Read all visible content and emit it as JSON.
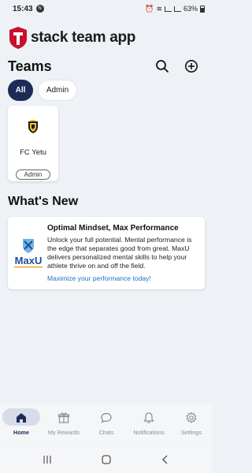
{
  "status_bar": {
    "time": "15:43",
    "notification_badge": "N",
    "battery": "63%"
  },
  "app": {
    "name": "stack team app",
    "brand_color": "#c8102e"
  },
  "teams": {
    "title": "Teams",
    "filters": [
      {
        "label": "All",
        "selected": true
      },
      {
        "label": "Admin",
        "selected": false
      }
    ],
    "cards": [
      {
        "name": "FC Yetu",
        "role": "Admin"
      }
    ]
  },
  "whats_new": {
    "title": "What's New",
    "items": [
      {
        "title": "Optimal Mindset, Max Performance",
        "body": "Unlock your full potential. Mental performance is the edge that separates good from great. MaxU delivers personalized mental skills to help your athlete thrive on and off the field.",
        "link": "Maximize your performance today!",
        "image_text": "MaxU"
      }
    ]
  },
  "bottom_nav": [
    {
      "label": "Home",
      "icon": "home-icon",
      "active": true
    },
    {
      "label": "My Rewards",
      "icon": "gift-icon",
      "active": false
    },
    {
      "label": "Chats",
      "icon": "chat-bubble-icon",
      "active": false
    },
    {
      "label": "Notifications",
      "icon": "bell-icon",
      "active": false
    },
    {
      "label": "Settings",
      "icon": "gear-icon",
      "active": false
    }
  ],
  "colors": {
    "accent": "#1d2b57",
    "link": "#1f6fc4",
    "background": "#eef1f5"
  }
}
